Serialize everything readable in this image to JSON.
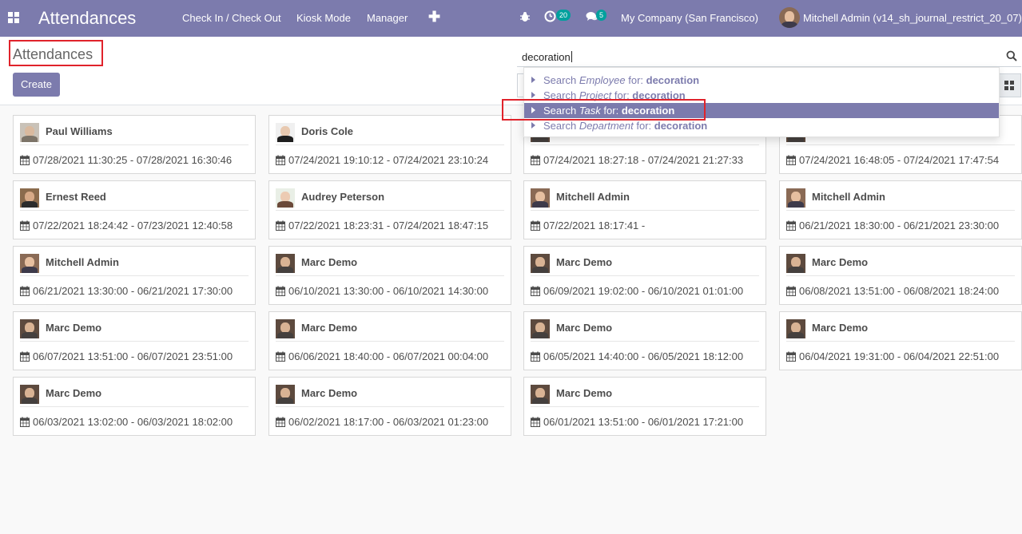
{
  "navbar": {
    "brand": "Attendances",
    "menu": [
      "Check In / Check Out",
      "Kiosk Mode",
      "Manager"
    ],
    "activity_count": "20",
    "message_count": "5",
    "company": "My Company (San Francisco)",
    "user": "Mitchell Admin (v14_sh_journal_restrict_20_07)"
  },
  "control_panel": {
    "title": "Attendances",
    "create_label": "Create",
    "search_value": "decoration"
  },
  "autocomplete": [
    {
      "prefix": "Search ",
      "field": "Employee",
      "mid": " for: ",
      "term": "decoration",
      "active": false
    },
    {
      "prefix": "Search ",
      "field": "Project",
      "mid": " for: ",
      "term": "decoration",
      "active": false
    },
    {
      "prefix": "Search ",
      "field": "Task",
      "mid": " for: ",
      "term": "decoration",
      "active": true
    },
    {
      "prefix": "Search ",
      "field": "Department",
      "mid": " for: ",
      "term": "decoration",
      "active": false
    }
  ],
  "cards": [
    {
      "name": "Paul Williams",
      "dates": "07/28/2021 11:30:25 - 07/28/2021 16:30:46",
      "avatar": "paul"
    },
    {
      "name": "Doris Cole",
      "dates": "07/24/2021 19:10:12 - 07/24/2021 23:10:24",
      "avatar": "doris"
    },
    {
      "name": "",
      "dates": "07/24/2021 18:27:18 - 07/24/2021 21:27:33",
      "avatar": "hidden"
    },
    {
      "name": "",
      "dates": "07/24/2021 16:48:05 - 07/24/2021 17:47:54",
      "avatar": "hidden"
    },
    {
      "name": "Ernest Reed",
      "dates": "07/22/2021 18:24:42 - 07/23/2021 12:40:58",
      "avatar": "ernest"
    },
    {
      "name": "Audrey Peterson",
      "dates": "07/22/2021 18:23:31 - 07/24/2021 18:47:15",
      "avatar": "audrey"
    },
    {
      "name": "Mitchell Admin",
      "dates": "07/22/2021 18:17:41 -",
      "avatar": "mitchell"
    },
    {
      "name": "Mitchell Admin",
      "dates": "06/21/2021 18:30:00 - 06/21/2021 23:30:00",
      "avatar": "mitchell"
    },
    {
      "name": "Mitchell Admin",
      "dates": "06/21/2021 13:30:00 - 06/21/2021 17:30:00",
      "avatar": "mitchell"
    },
    {
      "name": "Marc Demo",
      "dates": "06/10/2021 13:30:00 - 06/10/2021 14:30:00",
      "avatar": "marc"
    },
    {
      "name": "Marc Demo",
      "dates": "06/09/2021 19:02:00 - 06/10/2021 01:01:00",
      "avatar": "marc"
    },
    {
      "name": "Marc Demo",
      "dates": "06/08/2021 13:51:00 - 06/08/2021 18:24:00",
      "avatar": "marc"
    },
    {
      "name": "Marc Demo",
      "dates": "06/07/2021 13:51:00 - 06/07/2021 23:51:00",
      "avatar": "marc"
    },
    {
      "name": "Marc Demo",
      "dates": "06/06/2021 18:40:00 - 06/07/2021 00:04:00",
      "avatar": "marc"
    },
    {
      "name": "Marc Demo",
      "dates": "06/05/2021 14:40:00 - 06/05/2021 18:12:00",
      "avatar": "marc"
    },
    {
      "name": "Marc Demo",
      "dates": "06/04/2021 19:31:00 - 06/04/2021 22:51:00",
      "avatar": "marc"
    },
    {
      "name": "Marc Demo",
      "dates": "06/03/2021 13:02:00 - 06/03/2021 18:02:00",
      "avatar": "marc"
    },
    {
      "name": "Marc Demo",
      "dates": "06/02/2021 18:17:00 - 06/03/2021 01:23:00",
      "avatar": "marc"
    },
    {
      "name": "Marc Demo",
      "dates": "06/01/2021 13:51:00 - 06/01/2021 17:21:00",
      "avatar": "marc"
    }
  ],
  "colors": {
    "brand": "#7c7bad",
    "highlight": "#e0232b",
    "badge": "#00a09d"
  }
}
